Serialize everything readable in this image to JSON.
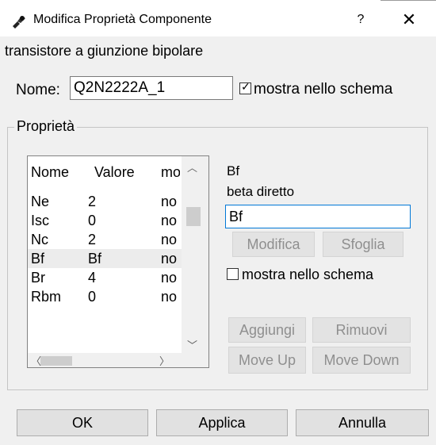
{
  "window": {
    "title": "Modifica Proprietà Componente",
    "app_icon": "qucs-transistor-icon",
    "help_label": "?",
    "close_label": "✕"
  },
  "component": {
    "type_label": "transistore a giunzione bipolare",
    "name_label": "Nome:",
    "name_value": "Q2N2222A_1",
    "show_in_schematic_label": "mostra nello schema",
    "show_in_schematic_checked": true
  },
  "properties": {
    "group_title": "Proprietà",
    "columns": [
      "Nome",
      "Valore",
      "mo"
    ],
    "rows": [
      {
        "name": "Ne",
        "value": "2",
        "show": "no"
      },
      {
        "name": "Isc",
        "value": "0",
        "show": "no"
      },
      {
        "name": "Nc",
        "value": "2",
        "show": "no"
      },
      {
        "name": "Bf",
        "value": "Bf",
        "show": "no",
        "selected": true
      },
      {
        "name": "Br",
        "value": "4",
        "show": "no"
      },
      {
        "name": "Rbm",
        "value": "0",
        "show": "no"
      }
    ]
  },
  "detail": {
    "prop_name": "Bf",
    "prop_desc": "beta diretto",
    "prop_value": "Bf",
    "modify_label": "Modifica",
    "browse_label": "Sfoglia",
    "show_label": "mostra nello schema",
    "show_checked": false,
    "add_label": "Aggiungi",
    "remove_label": "Rimuovi",
    "move_up_label": "Move Up",
    "move_down_label": "Move Down"
  },
  "buttons": {
    "ok_label": "OK",
    "apply_label": "Applica",
    "cancel_label": "Annulla"
  },
  "colors": {
    "accent_focus_border": "#0078d7",
    "selected_row": "#ececec"
  }
}
